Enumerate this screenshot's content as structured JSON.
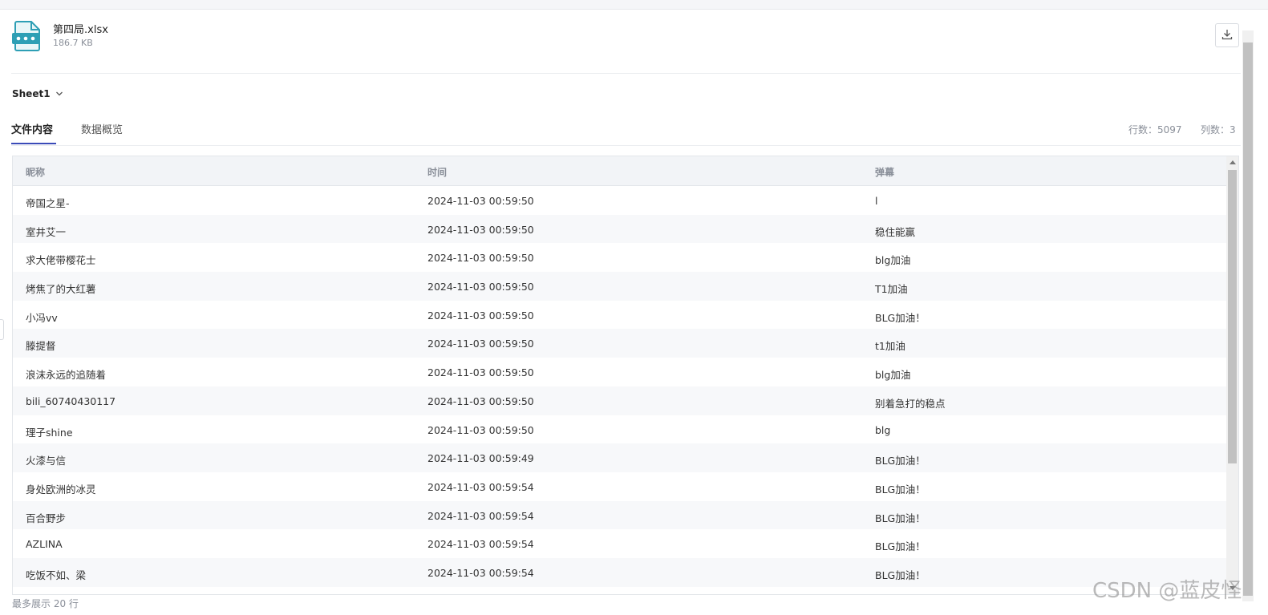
{
  "file": {
    "name": "第四局.xlsx",
    "size": "186.7 KB",
    "icon": "spreadsheet-file-icon",
    "icon_color": "#2e9fb5"
  },
  "download": {
    "icon": "download-icon"
  },
  "sheet": {
    "label": "Sheet1",
    "icon": "chevron-down-icon"
  },
  "tabs": [
    {
      "label": "文件内容",
      "active": true
    },
    {
      "label": "数据概览",
      "active": false
    }
  ],
  "stats": {
    "rows": "行数：5097",
    "cols": "列数：3"
  },
  "table": {
    "headers": [
      "昵称",
      "时间",
      "弹幕"
    ],
    "rows": [
      [
        "帝国之星-",
        "2024-11-03 00:59:50",
        "l"
      ],
      [
        "室井艾一",
        "2024-11-03 00:59:50",
        "稳住能赢"
      ],
      [
        "求大佬带樱花士",
        "2024-11-03 00:59:50",
        "blg加油"
      ],
      [
        "烤焦了的大红薯",
        "2024-11-03 00:59:50",
        "T1加油"
      ],
      [
        "小冯vv",
        "2024-11-03 00:59:50",
        "BLG加油！"
      ],
      [
        "滕提督",
        "2024-11-03 00:59:50",
        "t1加油"
      ],
      [
        "浪沫永远的追随着",
        "2024-11-03 00:59:50",
        "blg加油"
      ],
      [
        "bili_60740430117",
        "2024-11-03 00:59:50",
        "别着急打的稳点"
      ],
      [
        "理子shine",
        "2024-11-03 00:59:50",
        "blg"
      ],
      [
        "火漆与信",
        "2024-11-03 00:59:49",
        "BLG加油！"
      ],
      [
        "身处欧洲的冰灵",
        "2024-11-03 00:59:54",
        "BLG加油！"
      ],
      [
        "百合野步",
        "2024-11-03 00:59:54",
        "BLG加油！"
      ],
      [
        "AZLINA",
        "2024-11-03 00:59:54",
        "BLG加油！"
      ],
      [
        "吃饭不如、梁",
        "2024-11-03 00:59:54",
        "BLG加油！"
      ]
    ]
  },
  "footer": "最多展示 20 行",
  "watermark": "CSDN @蓝皮怪",
  "colors": {
    "accent": "#3a4bb8",
    "header_bg": "#f2f4f7"
  }
}
